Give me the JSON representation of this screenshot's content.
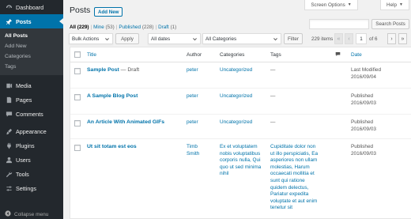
{
  "sidebar": {
    "top_items": [
      {
        "label": "Dashboard",
        "icon": "dashboard-icon"
      },
      {
        "label": "Posts",
        "icon": "pin-icon"
      }
    ],
    "submenu": [
      "All Posts",
      "Add New",
      "Categories",
      "Tags"
    ],
    "items": [
      {
        "label": "Media",
        "icon": "media-icon"
      },
      {
        "label": "Pages",
        "icon": "page-icon"
      },
      {
        "label": "Comments",
        "icon": "comment-icon"
      },
      {
        "label": "Appearance",
        "icon": "brush-icon"
      },
      {
        "label": "Plugins",
        "icon": "plug-icon"
      },
      {
        "label": "Users",
        "icon": "user-icon"
      },
      {
        "label": "Tools",
        "icon": "wrench-icon"
      },
      {
        "label": "Settings",
        "icon": "settings-icon"
      }
    ],
    "collapse_label": "Collapse menu"
  },
  "header": {
    "title": "Posts",
    "add_new": "Add New",
    "screen_options": "Screen Options",
    "help": "Help"
  },
  "views": {
    "all": "All",
    "all_count": "(229)",
    "mine": "Mine",
    "mine_count": "(53)",
    "published": "Published",
    "published_count": "(228)",
    "draft": "Draft",
    "draft_count": "(1)",
    "separator": "|"
  },
  "search": {
    "value": "",
    "button": "Search Posts"
  },
  "filters": {
    "bulk_actions": "Bulk Actions",
    "apply": "Apply",
    "dates": "All dates",
    "categories": "All Categories",
    "filter": "Filter"
  },
  "pagination": {
    "items": "229 items",
    "first": "«",
    "prev": "‹",
    "current_page": "1",
    "of_text": "of 6",
    "next": "›",
    "last": "»"
  },
  "table": {
    "columns": {
      "title": "Title",
      "author": "Author",
      "categories": "Categories",
      "tags": "Tags",
      "comments_icon": "comment-bubble-icon",
      "date": "Date"
    },
    "rows": [
      {
        "title": "Sample Post",
        "state": " — Draft",
        "author": "peter",
        "categories": "Uncategorized",
        "tags": "—",
        "date_status": "Last Modified",
        "date": "2016/09/04"
      },
      {
        "title": "A Sample Blog Post",
        "state": "",
        "author": "peter",
        "categories": "Uncategorized",
        "tags": "—",
        "date_status": "Published",
        "date": "2016/09/03"
      },
      {
        "title": "An Article With Animated GIFs",
        "state": "",
        "author": "peter",
        "categories": "Uncategorized",
        "tags": "—",
        "date_status": "Published",
        "date": "2016/09/03"
      },
      {
        "title": "Ut sit totam est eos",
        "state": "",
        "author": "Timb Smith",
        "categories": "Ex et voluptatem nobis voluptatibus corporis nulla, Qui quo ut sed minima nihil",
        "tags": "Cupiditate dolor non ut illo perspiciatis, Ea asperiores non ullam molestias, Harum occaecati mollitia et sunt qui ratione quidem delectus, Pariatur expedita voluptate et aut enim tenetur sit",
        "date_status": "Published",
        "date": "2016/09/03"
      }
    ]
  },
  "colors": {
    "sidebar_bg": "#23282d",
    "accent": "#0073aa",
    "page_bg": "#f1f1f1"
  }
}
